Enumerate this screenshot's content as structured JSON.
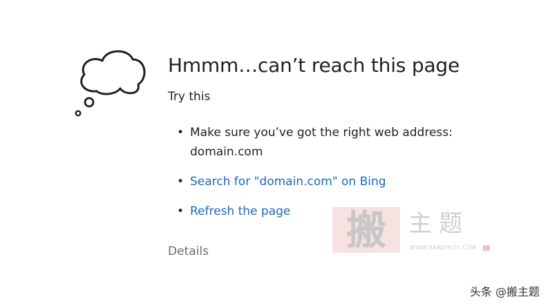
{
  "error_page": {
    "title": "Hmmm…can’t reach this page",
    "subtitle": "Try this",
    "suggestions": [
      {
        "text": "Make sure you’ve got the right web address: domain.com"
      },
      {
        "text": "Search for \"domain.com\" on Bing"
      },
      {
        "text": "Refresh the page"
      }
    ],
    "details_label": "Details",
    "bullet": "•"
  },
  "icons": {
    "illustration": "thought-cloud-icon"
  },
  "colors": {
    "text": "#202124",
    "link": "#1a68c4",
    "details": "#6b6b6b",
    "background": "#ffffff"
  },
  "watermark": {
    "seal_char": "搬",
    "brand": "主题",
    "url": "WWW.BANZHUTI.COM"
  },
  "source_credit": "头条 @搬主题"
}
